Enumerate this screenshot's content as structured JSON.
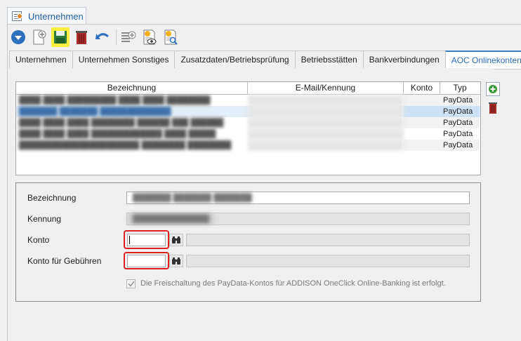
{
  "document_tab": {
    "label": "Unternehmen"
  },
  "toolbar": {
    "items": [
      {
        "name": "dropdown-menu-icon",
        "highlighted": false
      },
      {
        "name": "new-document-icon",
        "highlighted": false
      },
      {
        "name": "save-icon",
        "highlighted": true
      },
      {
        "name": "delete-icon",
        "highlighted": false
      },
      {
        "name": "undo-icon",
        "highlighted": false
      },
      {
        "name": "add-list-icon",
        "highlighted": false
      },
      {
        "name": "preview-document-icon",
        "highlighted": false
      },
      {
        "name": "search-document-icon",
        "highlighted": false
      }
    ],
    "accent_yellow": "#f9ef3f"
  },
  "tabs": [
    {
      "label": "Unternehmen",
      "active": false
    },
    {
      "label": "Unternehmen Sonstiges",
      "active": false
    },
    {
      "label": "Zusatzdaten/Betriebsprüfung",
      "active": false
    },
    {
      "label": "Betriebsstätten",
      "active": false
    },
    {
      "label": "Bankverbindungen",
      "active": false
    },
    {
      "label": "AOC Onlinekonten",
      "active": true
    }
  ],
  "table": {
    "columns": [
      "Bezeichnung",
      "E-Mail/Kennung",
      "Konto",
      "Typ"
    ],
    "rows": [
      {
        "bezeichnung": "████ ████ █████████ ████ ████ ████████",
        "email": "",
        "konto": "",
        "typ": "PayData",
        "selected": false
      },
      {
        "bezeichnung": "███████ ███████ █████████████",
        "email": "",
        "konto": "",
        "typ": "PayData",
        "selected": true
      },
      {
        "bezeichnung": "████ ████ ████ ████████ ██████ ███ ██████",
        "email": "",
        "konto": "",
        "typ": "PayData",
        "selected": false
      },
      {
        "bezeichnung": "████ ████ ████ █████████████ ████ █████",
        "email": "",
        "konto": "",
        "typ": "PayData",
        "selected": false
      },
      {
        "bezeichnung": "██████████████████████ ████████ ████████",
        "email": "",
        "konto": "",
        "typ": "PayData",
        "selected": false
      }
    ]
  },
  "side_buttons": [
    {
      "name": "add-account-icon"
    },
    {
      "name": "delete-account-icon"
    }
  ],
  "form": {
    "bezeichnung": {
      "label": "Bezeichnung",
      "value": "███████ ███████ ███████"
    },
    "kennung": {
      "label": "Kennung",
      "value": "██████████████"
    },
    "konto": {
      "label": "Konto",
      "value": ""
    },
    "konto_gebuehren": {
      "label": "Konto für Gebühren",
      "value": ""
    },
    "freischaltung": {
      "label": "Die Freischaltung des PayData-Kontos für ADDISON OneClick Online-Banking ist erfolgt.",
      "checked": true,
      "disabled": true
    }
  },
  "colors": {
    "active_tab_text": "#2b6cb5",
    "highlight_frame": "#e02020",
    "selected_row": "#cce3f7"
  }
}
